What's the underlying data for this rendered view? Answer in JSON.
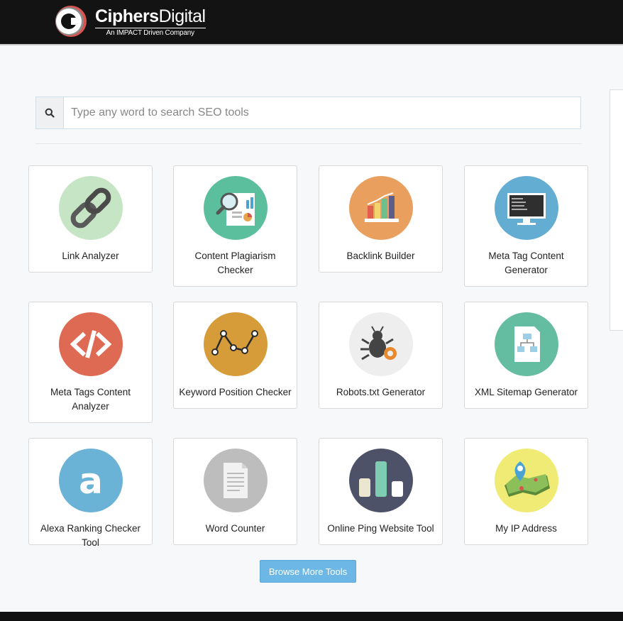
{
  "header": {
    "logo_name_bold": "Ciphers",
    "logo_name_light": "Digital",
    "logo_tagline": "An IMPACT Driven Company"
  },
  "search": {
    "placeholder": "Type any word to search SEO tools",
    "icon": "search-icon"
  },
  "tools": [
    {
      "label": "Link Analyzer",
      "icon": "chain-link-icon",
      "color": "#c6e5c4"
    },
    {
      "label": "Content Plagiarism Checker",
      "icon": "magnifier-report-icon",
      "color": "#5bbf9d"
    },
    {
      "label": "Backlink Builder",
      "icon": "bar-chart-icon",
      "color": "#e9a05f"
    },
    {
      "label": "Meta Tag Content Generator",
      "icon": "monitor-code-icon",
      "color": "#63acd2"
    },
    {
      "label": "Meta Tags Content Analyzer",
      "icon": "code-brackets-icon",
      "color": "#df6a53"
    },
    {
      "label": "Keyword Position Checker",
      "icon": "line-graph-icon",
      "color": "#d79c3a"
    },
    {
      "label": "Robots.txt Generator",
      "icon": "bug-wrench-icon",
      "color": "#eeeeee"
    },
    {
      "label": "XML Sitemap Generator",
      "icon": "sitemap-document-icon",
      "color": "#64bca1"
    },
    {
      "label": "Alexa Ranking Checker Tool",
      "icon": "alexa-a-icon",
      "color": "#6bb3d6"
    },
    {
      "label": "Word Counter",
      "icon": "document-icon",
      "color": "#bdbdbd"
    },
    {
      "label": "Online Ping Website Tool",
      "icon": "signal-bars-icon",
      "color": "#4e5269"
    },
    {
      "label": "My IP Address",
      "icon": "map-pin-icon",
      "color": "#efeb75"
    }
  ],
  "browse_button": "Browse More Tools"
}
